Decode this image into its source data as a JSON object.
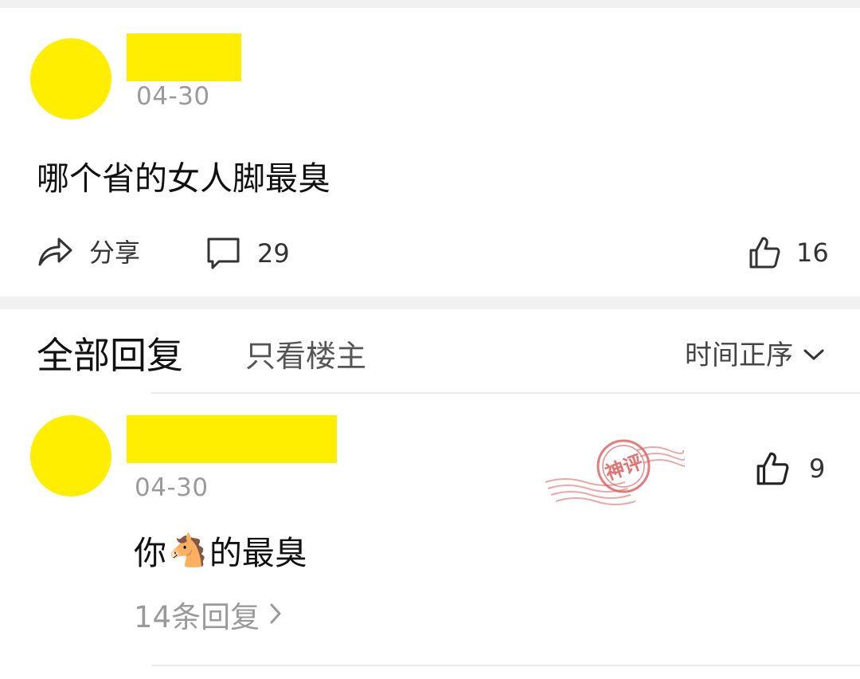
{
  "post": {
    "date": "04-30",
    "text": "哪个省的女人脚最臭",
    "share_label": "分享",
    "comment_count": "29",
    "like_count": "16"
  },
  "tabs": {
    "all_replies": "全部回复",
    "op_only": "只看楼主",
    "sort_label": "时间正序"
  },
  "comment": {
    "date": "04-30",
    "text_before": "你",
    "emoji": "🐴",
    "text_after": "的最臭",
    "like_count": "9",
    "replies_label": "14条回复",
    "stamp_text": "神评"
  },
  "colors": {
    "avatar_mask": "#ffee00",
    "stamp_red": "#e05a5a",
    "muted_text": "#9a9a9a"
  }
}
